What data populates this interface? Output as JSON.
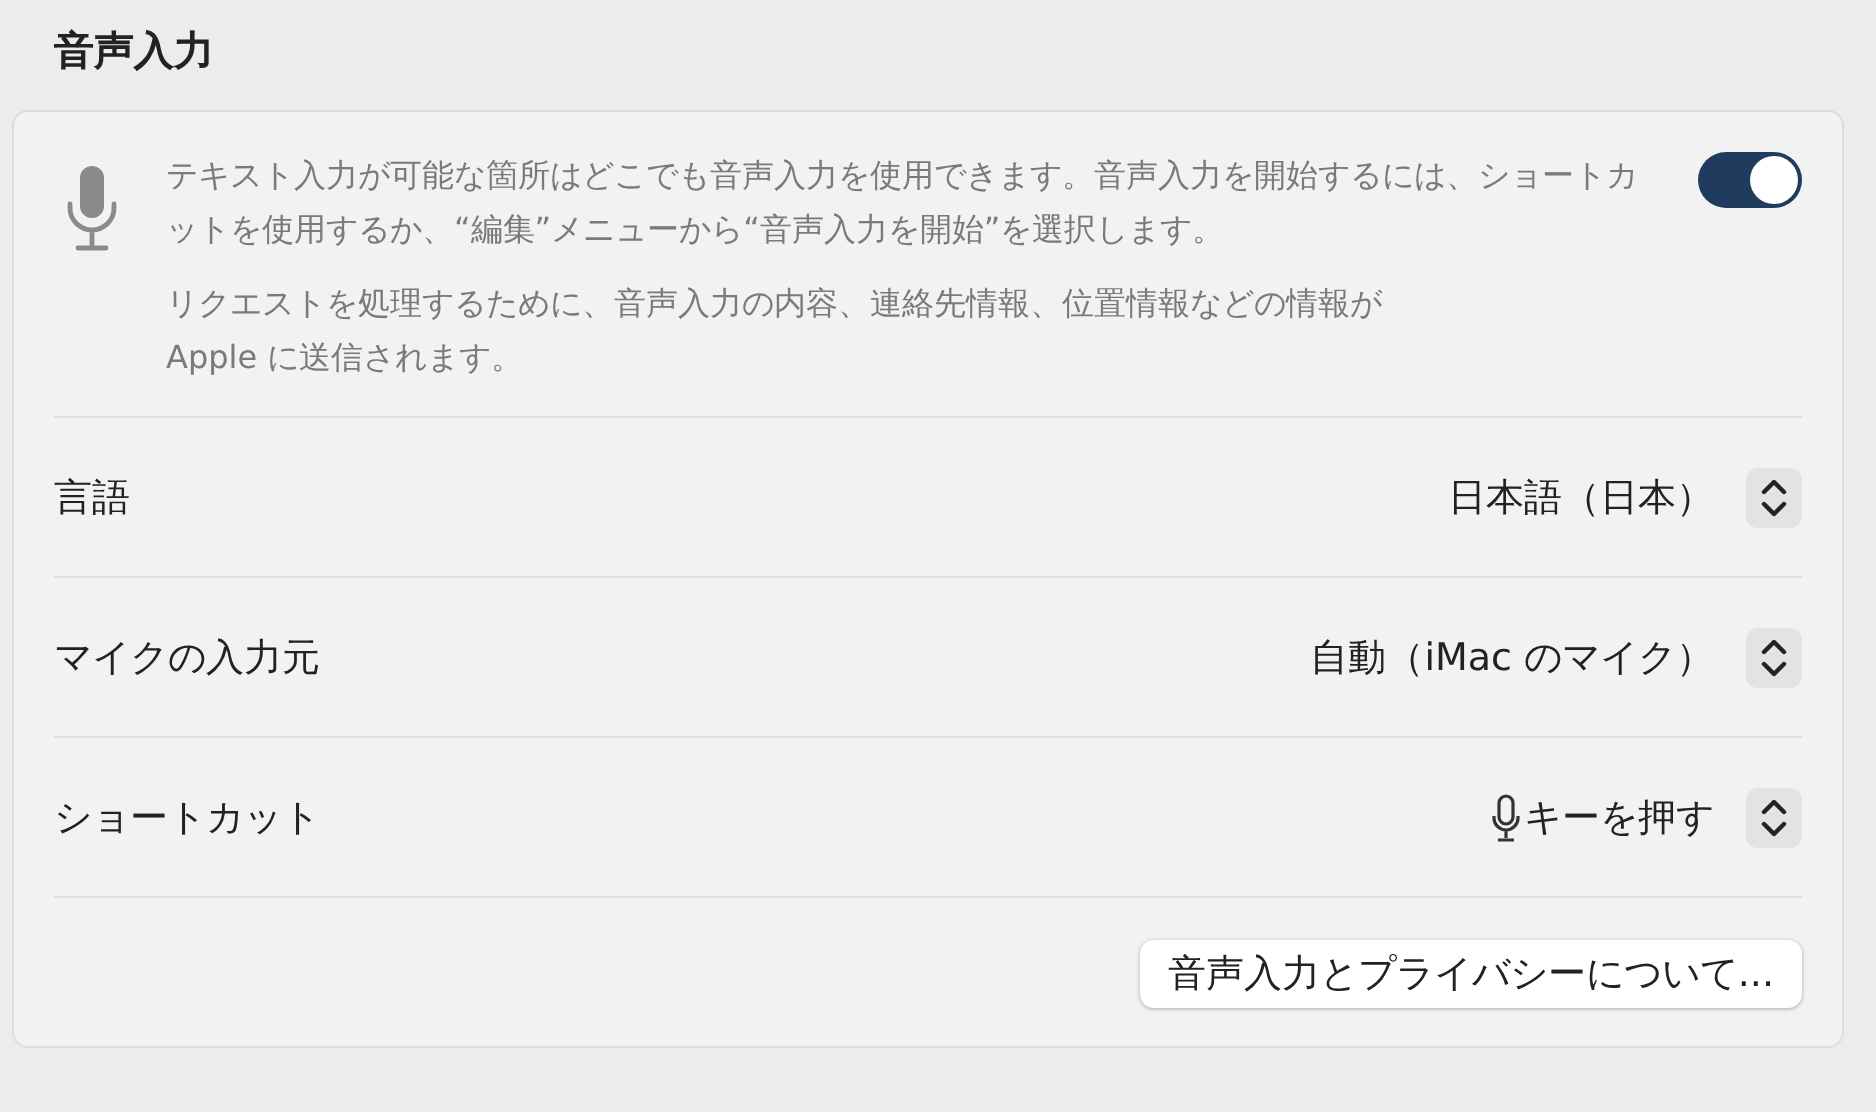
{
  "title": "音声入力",
  "dictation": {
    "description": "テキスト入力が可能な箇所はどこでも音声入力を使用できます。音声入力を開始するには、ショートカットを使用するか、“編集”メニューから“音声入力を開始”を選択します。",
    "privacy_note": "リクエストを処理するために、音声入力の内容、連絡先情報、位置情報などの情報がApple に送信されます。",
    "on": true
  },
  "settings": [
    {
      "kind": "popup",
      "label": "言語",
      "value": "日本語（日本）"
    },
    {
      "kind": "popup",
      "label": "マイクの入力元",
      "value": "自動（iMac のマイク）"
    },
    {
      "kind": "mic-popup",
      "label": "ショートカット",
      "value": "キーを押す"
    }
  ],
  "button": "音声入力とプライバシーについて..."
}
